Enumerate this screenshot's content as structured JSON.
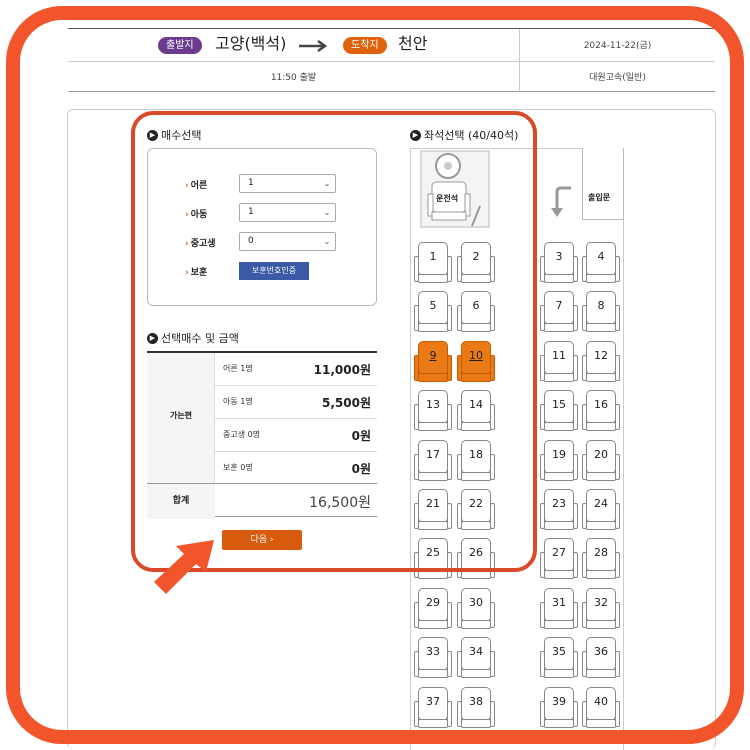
{
  "header": {
    "departure_badge": "출발지",
    "departure_city": "고양(백석)",
    "arrival_badge": "도착지",
    "arrival_city": "천안",
    "date": "2024-11-22(금)",
    "departure_time": "11:50 출발",
    "bus_grade": "대원고속(일반)"
  },
  "ticket_count": {
    "title": "매수선택",
    "rows": [
      {
        "label": "어른",
        "value": "1"
      },
      {
        "label": "아동",
        "value": "1"
      },
      {
        "label": "중고생",
        "value": "0"
      }
    ],
    "guardian_label": "보훈",
    "guardian_button": "보훈번호인증"
  },
  "fare": {
    "title": "선택매수 및 금액",
    "direction": "가는편",
    "rows": [
      {
        "label": "어른 1명",
        "amount": "11,000원"
      },
      {
        "label": "아동 1명",
        "amount": "5,500원"
      },
      {
        "label": "중고생 0명",
        "amount": "0원"
      },
      {
        "label": "보훈 0명",
        "amount": "0원"
      }
    ],
    "total_label": "합계",
    "total_amount": "16,500원"
  },
  "next_button": "다음",
  "seat_map": {
    "title": "좌석선택 (40/40석)",
    "driver_label": "운전석",
    "door_label": "출입문",
    "selected": [
      9,
      10
    ],
    "seats": [
      "1",
      "2",
      "3",
      "4",
      "5",
      "6",
      "7",
      "8",
      "9",
      "10",
      "11",
      "12",
      "13",
      "14",
      "15",
      "16",
      "17",
      "18",
      "19",
      "20",
      "21",
      "22",
      "23",
      "24",
      "25",
      "26",
      "27",
      "28",
      "29",
      "30",
      "31",
      "32",
      "33",
      "34",
      "35",
      "36",
      "37",
      "38",
      "39",
      "40"
    ]
  },
  "colors": {
    "frame": "#f2552c",
    "highlight": "#d94a2a",
    "selected_seat": "#ea7a16",
    "departure_badge": "#6c3b8e",
    "arrival_badge": "#e0620d",
    "next_button": "#d85a0c"
  }
}
